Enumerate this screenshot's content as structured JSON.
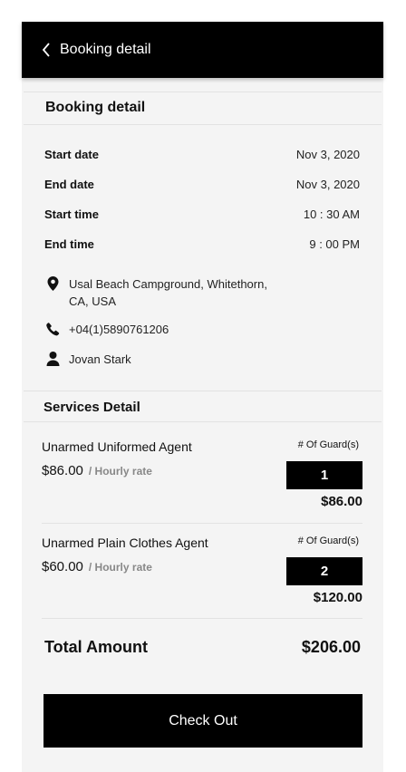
{
  "header": {
    "title": "Booking detail"
  },
  "booking": {
    "title": "Booking detail",
    "rows": [
      {
        "label": "Start date",
        "value": "Nov 3, 2020"
      },
      {
        "label": "End date",
        "value": "Nov 3, 2020"
      },
      {
        "label": "Start time",
        "value": "10 : 30 AM"
      },
      {
        "label": "End time",
        "value": "9 : 00 PM"
      }
    ],
    "location_line1": "Usal Beach Campground, Whitethorn,",
    "location_line2": "CA, USA",
    "phone": "+04(1)5890761206",
    "name": "Jovan Stark",
    "icons": {
      "location": "location-pin-icon",
      "phone": "phone-icon",
      "user": "user-icon"
    }
  },
  "services": {
    "title": "Services Detail",
    "guard_label": "# Of Guard(s)",
    "rate_label": "/ Hourly rate",
    "items": [
      {
        "name": "Unarmed Uniformed Agent",
        "price": "$86.00",
        "guards": "1",
        "total": "$86.00"
      },
      {
        "name": "Unarmed Plain Clothes Agent",
        "price": "$60.00",
        "guards": "2",
        "total": "$120.00"
      }
    ]
  },
  "total": {
    "label": "Total Amount",
    "value": "$206.00"
  },
  "checkout_label": "Check Out",
  "colors": {
    "header_bg": "#000000",
    "page_bg": "#f4f4f4",
    "button_bg": "#000000",
    "muted": "#888888"
  }
}
